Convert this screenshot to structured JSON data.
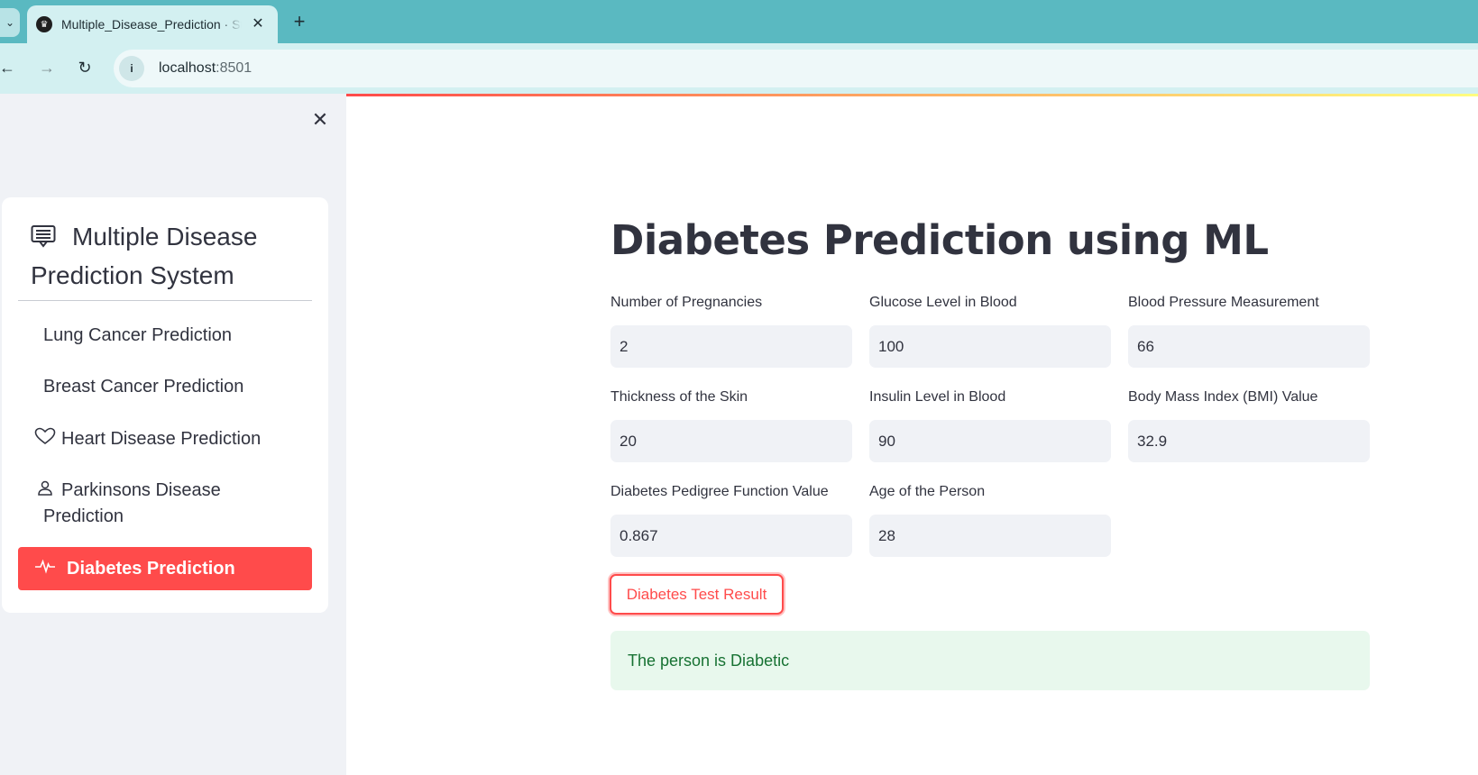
{
  "browser": {
    "tab_title": "Multiple_Disease_Prediction · Streamlit",
    "url_host": "localhost",
    "url_port": ":8501",
    "tab_dropdown_icon": "chevron-down",
    "new_tab_icon": "plus"
  },
  "sidebar": {
    "close_icon": "close",
    "menu_title": "Multiple Disease Prediction System",
    "menu_title_icon": "list-alt",
    "items": [
      {
        "label": "Lung Cancer Prediction",
        "icon": ""
      },
      {
        "label": "Breast Cancer Prediction",
        "icon": ""
      },
      {
        "label": "Heart Disease Prediction",
        "icon": "heart"
      },
      {
        "label": "Parkinsons Disease Prediction",
        "icon": "person"
      },
      {
        "label": "Diabetes Prediction",
        "icon": "activity",
        "active": true
      }
    ]
  },
  "main": {
    "title": "Diabetes Prediction using ML",
    "fields": [
      {
        "label": "Number of Pregnancies",
        "value": "2"
      },
      {
        "label": "Glucose Level in Blood",
        "value": "100"
      },
      {
        "label": "Blood Pressure Measurement",
        "value": "66"
      },
      {
        "label": "Thickness of the Skin",
        "value": "20"
      },
      {
        "label": "Insulin Level in Blood",
        "value": "90"
      },
      {
        "label": "Body Mass Index (BMI) Value",
        "value": "32.9"
      },
      {
        "label": "Diabetes Pedigree Function Value",
        "value": "0.867"
      },
      {
        "label": "Age of the Person",
        "value": "28"
      }
    ],
    "button_label": "Diabetes Test Result",
    "result_text": "The person is Diabetic"
  },
  "colors": {
    "accent": "#ff4b4b",
    "chrome": "#5ab9c1",
    "success_bg": "#e8f8ed",
    "success_text": "#177233"
  }
}
